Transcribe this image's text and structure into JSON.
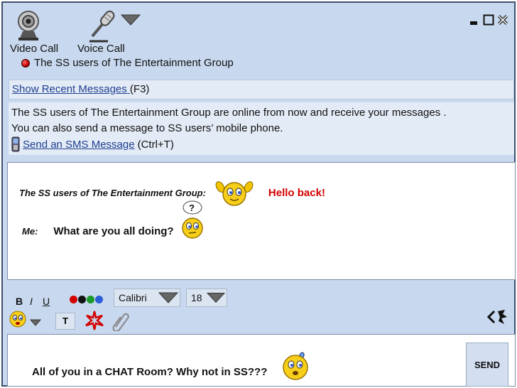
{
  "toolbar": {
    "video_call_label": "Video Call",
    "voice_call_label": "Voice Call",
    "status_text": "The SS users of The Entertainment Group"
  },
  "recent": {
    "link_text": "Show Recent Messages ",
    "shortcut": "(F3)"
  },
  "notice": {
    "line1": "The SS users of The Entertainment Group are online from now and receive your messages .",
    "line2": "You can also send a message to SS users’ mobile phone.",
    "sms_link": "Send an SMS Message ",
    "sms_shortcut": "(Ctrl+T)"
  },
  "chat": {
    "messages": [
      {
        "sender": "The SS users of The Entertainment Group:",
        "text": "Hello back!"
      },
      {
        "sender": "Me:",
        "text": "What are you all doing?"
      }
    ]
  },
  "format": {
    "bold": "B",
    "italic": "I",
    "underline": "U",
    "font": "Calibri",
    "size": "18",
    "text_button": "T",
    "colors": [
      "#d40000",
      "#111111",
      "#1a9a2a",
      "#2a5fd8"
    ]
  },
  "compose": {
    "text": "All of you in a CHAT Room? Why not in SS???",
    "send_label": "SEND"
  },
  "icons": {
    "video": "webcam-icon",
    "voice": "microphone-icon",
    "minimize": "minimize-icon",
    "maximize": "maximize-icon",
    "close": "close-icon",
    "phone": "mobile-phone-icon",
    "emoji": "smiley-icon",
    "nudge": "nudge-icon",
    "attach": "paperclip-icon",
    "collapse": "collapse-icon"
  }
}
